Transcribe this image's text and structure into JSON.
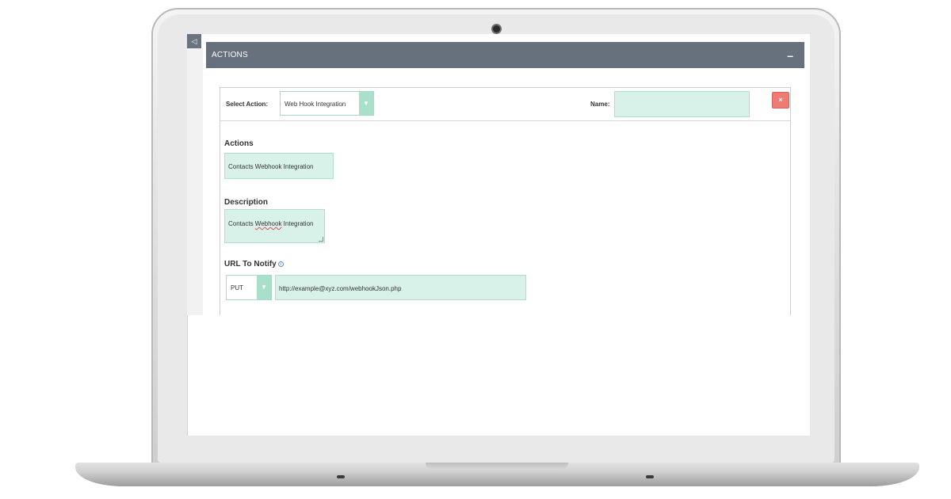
{
  "panel": {
    "title": "ACTIONS",
    "minimize_label": "–",
    "collapse_label": "◁"
  },
  "action": {
    "select_action_label": "Select Action:",
    "select_action_value": "Web Hook Integration",
    "name_label": "Name:",
    "name_value": "",
    "remove_label": "×"
  },
  "fields": {
    "actions_label": "Actions",
    "actions_value": "Contacts Webhook Integration",
    "description_label": "Description",
    "description_prefix": "Contacts ",
    "description_misspelled": "Webhook",
    "description_suffix": " Integration",
    "url_label": "URL To Notify",
    "url_method": "PUT",
    "url_value": "http://example@xyz.com/webhookJson.php"
  },
  "icons": {
    "info": "info-icon",
    "dropdown": "chevron-down-icon",
    "remove": "close-icon",
    "collapse": "collapse-left-icon"
  },
  "colors": {
    "header": "#67717d",
    "input_fill": "#d8f2ea",
    "select_arrow": "#a9e0cc",
    "remove_button": "#ef7b73"
  }
}
